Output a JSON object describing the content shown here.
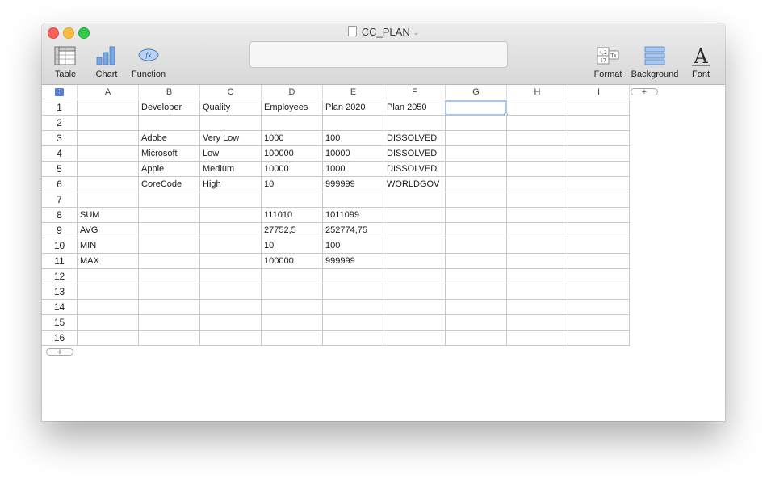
{
  "window": {
    "title": "CC_PLAN"
  },
  "toolbar": {
    "table_label": "Table",
    "chart_label": "Chart",
    "function_label": "Function",
    "format_label": "Format",
    "background_label": "Background",
    "font_label": "Font",
    "function_icon_text": "fx",
    "font_icon_text": "A",
    "format_icon_text": [
      "4,2",
      "17",
      "Tx"
    ]
  },
  "formula_bar": {
    "value": ""
  },
  "sheet": {
    "columns": [
      "A",
      "B",
      "C",
      "D",
      "E",
      "F",
      "G",
      "H",
      "I"
    ],
    "rows": [
      [
        "",
        "Developer",
        "Quality",
        "Employees",
        "Plan 2020",
        "Plan 2050",
        "",
        "",
        ""
      ],
      [
        "",
        "",
        "",
        "",
        "",
        "",
        "",
        "",
        ""
      ],
      [
        "",
        "Adobe",
        "Very Low",
        "1000",
        "100",
        "DISSOLVED",
        "",
        "",
        ""
      ],
      [
        "",
        "Microsoft",
        "Low",
        "100000",
        "10000",
        "DISSOLVED",
        "",
        "",
        ""
      ],
      [
        "",
        "Apple",
        "Medium",
        "10000",
        "1000",
        "DISSOLVED",
        "",
        "",
        ""
      ],
      [
        "",
        "CoreCode",
        "High",
        "10",
        "999999",
        "WORLDGOV",
        "",
        "",
        ""
      ],
      [
        "",
        "",
        "",
        "",
        "",
        "",
        "",
        "",
        ""
      ],
      [
        "SUM",
        "",
        "",
        "111010",
        "1011099",
        "",
        "",
        "",
        ""
      ],
      [
        "AVG",
        "",
        "",
        "27752,5",
        "252774,75",
        "",
        "",
        "",
        ""
      ],
      [
        "MIN",
        "",
        "",
        "10",
        "100",
        "",
        "",
        "",
        ""
      ],
      [
        "MAX",
        "",
        "",
        "100000",
        "999999",
        "",
        "",
        "",
        ""
      ],
      [
        "",
        "",
        "",
        "",
        "",
        "",
        "",
        "",
        ""
      ],
      [
        "",
        "",
        "",
        "",
        "",
        "",
        "",
        "",
        ""
      ],
      [
        "",
        "",
        "",
        "",
        "",
        "",
        "",
        "",
        ""
      ],
      [
        "",
        "",
        "",
        "",
        "",
        "",
        "",
        "",
        ""
      ],
      [
        "",
        "",
        "",
        "",
        "",
        "",
        "",
        "",
        ""
      ]
    ],
    "row_numbers": [
      "1",
      "2",
      "3",
      "4",
      "5",
      "6",
      "7",
      "8",
      "9",
      "10",
      "11",
      "12",
      "13",
      "14",
      "15",
      "16"
    ],
    "add_column_label": "+",
    "add_row_label": "+"
  },
  "colors": {
    "accent": "#4a90d9",
    "selection": "#a9c7ee"
  }
}
